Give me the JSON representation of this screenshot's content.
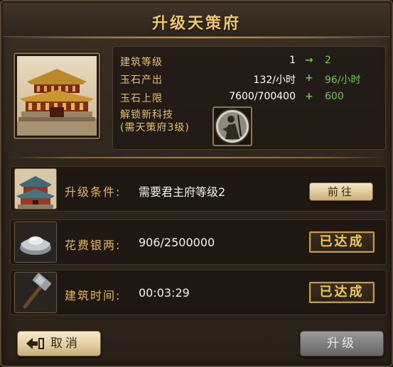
{
  "dialog": {
    "title": "升级天策府"
  },
  "info": {
    "building_level": {
      "label": "建筑等级",
      "from": "1",
      "arrow": "→",
      "to": "2"
    },
    "jade_output": {
      "label": "玉石产出",
      "from": "132/小时",
      "arrow": "+",
      "to": "96/小时"
    },
    "jade_cap": {
      "label": "玉石上限",
      "from": "7600/700400",
      "arrow": "+",
      "to": "600"
    },
    "unlock_tech": {
      "line1": "解锁新科技",
      "line2": "(需天策府3级)"
    }
  },
  "conditions": [
    {
      "label": "升级条件:",
      "value": "需要君主府等级2",
      "action": "前往",
      "icon": "palace-icon"
    },
    {
      "label": "花费银两:",
      "value": "906/2500000",
      "status": "已达成",
      "icon": "silver-ingot-icon"
    },
    {
      "label": "建筑时间:",
      "value": "00:03:29",
      "status": "已达成",
      "icon": "hammer-icon"
    }
  ],
  "footer": {
    "cancel_label": "取消",
    "upgrade_label": "升级"
  },
  "colors": {
    "accent_gold": "#e6c06a",
    "increase_green": "#77c850",
    "done_gold": "#f3c758"
  }
}
